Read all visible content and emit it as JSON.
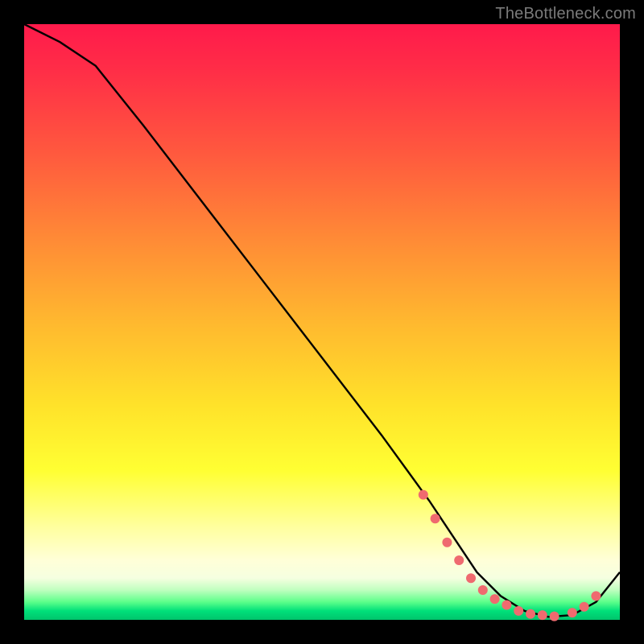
{
  "watermark": "TheBottleneck.com",
  "colors": {
    "frame": "#000000",
    "curve": "#000000",
    "marker": "#ef6a6f",
    "gradient_top": "#ff1a4b",
    "gradient_bottom": "#00c46c"
  },
  "chart_data": {
    "type": "line",
    "title": "",
    "xlabel": "",
    "ylabel": "",
    "xlim": [
      0,
      100
    ],
    "ylim": [
      0,
      100
    ],
    "grid": false,
    "legend": false,
    "series": [
      {
        "name": "bottleneck-curve",
        "x": [
          0,
          6,
          12,
          20,
          30,
          40,
          50,
          60,
          68,
          72,
          76,
          80,
          84,
          88,
          92,
          96,
          100
        ],
        "values": [
          100,
          97,
          93,
          83,
          70,
          57,
          44,
          31,
          20,
          14,
          8,
          4,
          1.5,
          0.5,
          0.8,
          3,
          8
        ]
      }
    ],
    "markers": {
      "name": "highlighted-points",
      "x": [
        67,
        69,
        71,
        73,
        75,
        77,
        79,
        81,
        83,
        85,
        87,
        89,
        92,
        94,
        96
      ],
      "values": [
        21,
        17,
        13,
        10,
        7,
        5,
        3.5,
        2.5,
        1.5,
        1,
        0.8,
        0.6,
        1.2,
        2.2,
        4
      ]
    }
  }
}
